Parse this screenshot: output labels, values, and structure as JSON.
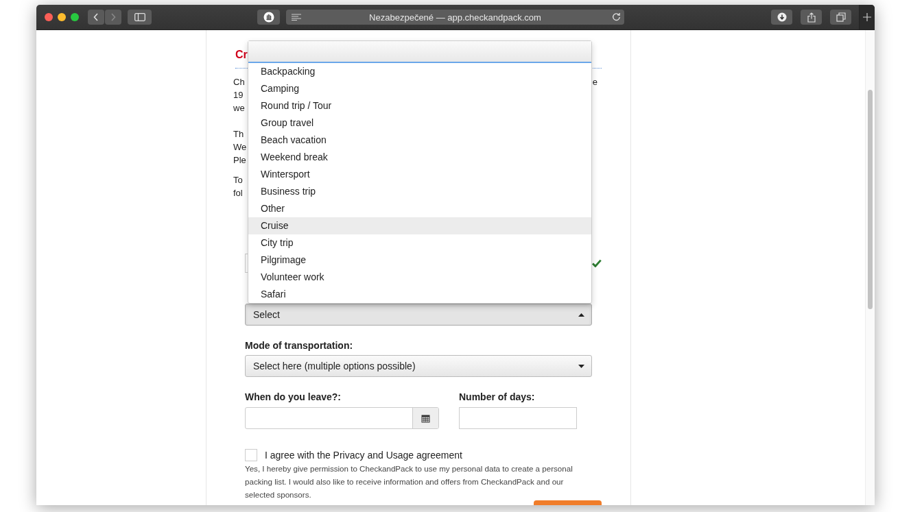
{
  "browser": {
    "address": "Nezabezpečené — app.checkandpack.com"
  },
  "page": {
    "heading": "Cr",
    "paragraphs": [
      {
        "lines": [
          {
            "text": "Ch",
            "tail": "e"
          },
          {
            "text": "19"
          },
          {
            "text": "we"
          }
        ]
      },
      {
        "lines": [
          {
            "text": "Th"
          },
          {
            "text": "We"
          },
          {
            "text": "Ple"
          }
        ]
      },
      {
        "lines": [
          {
            "text": "To"
          },
          {
            "text": "fol"
          }
        ]
      }
    ],
    "destination_field": {
      "valid": true
    },
    "trip_type": {
      "value": "Select",
      "expanded": true,
      "options": [
        {
          "label": "Backpacking",
          "selected": false
        },
        {
          "label": "Camping",
          "selected": false
        },
        {
          "label": "Round trip / Tour",
          "selected": false
        },
        {
          "label": "Group travel",
          "selected": false
        },
        {
          "label": "Beach vacation",
          "selected": false
        },
        {
          "label": "Weekend break",
          "selected": false
        },
        {
          "label": "Wintersport",
          "selected": false
        },
        {
          "label": "Business trip",
          "selected": false
        },
        {
          "label": "Other",
          "selected": false
        },
        {
          "label": "Cruise",
          "selected": true
        },
        {
          "label": "City trip",
          "selected": false
        },
        {
          "label": "Pilgrimage",
          "selected": false
        },
        {
          "label": "Volunteer work",
          "selected": false
        },
        {
          "label": "Safari",
          "selected": false
        }
      ]
    },
    "transport": {
      "label": "Mode of transportation:",
      "value": "Select here (multiple options possible)"
    },
    "departure": {
      "label": "When do you leave?:"
    },
    "days": {
      "label": "Number of days:"
    },
    "consent": {
      "label": "I agree with the Privacy and Usage agreement",
      "checked": false,
      "note": "Yes, I hereby give permission to CheckandPack to use my personal data to create a personal packing list. I would also like to receive information and offers from CheckandPack and our selected sponsors."
    }
  }
}
